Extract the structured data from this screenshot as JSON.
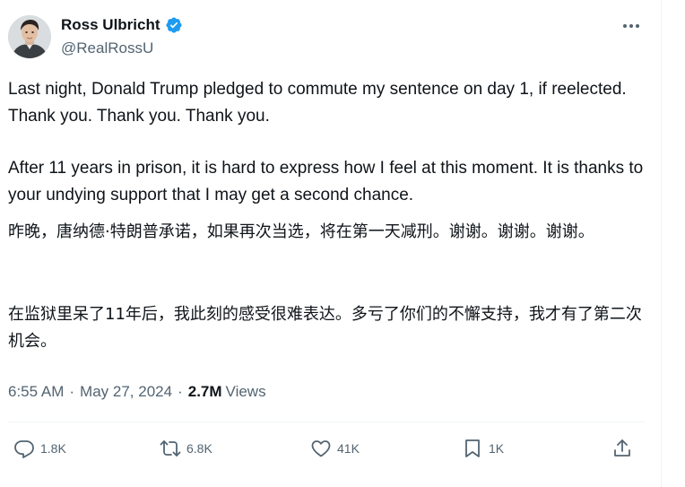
{
  "author": {
    "name": "Ross Ulbricht",
    "handle": "@RealRossU",
    "verified": true
  },
  "tweet": {
    "paragraphs": [
      "Last night, Donald Trump pledged to commute my sentence on day 1, if reelected. Thank you. Thank you. Thank you.",
      "After 11 years in prison, it is hard to express how I feel at this moment. It is thanks to your undying support that I may get a second chance.",
      "昨晚，唐纳德·特朗普承诺，如果再次当选，将在第一天减刑。谢谢。谢谢。谢谢。",
      "在监狱里呆了11年后，我此刻的感受很难表达。多亏了你们的不懈支持，我才有了第二次机会。"
    ],
    "time": "6:55 AM",
    "separator": "·",
    "date": "May 27, 2024",
    "views_count": "2.7M",
    "views_label": "Views"
  },
  "actions": {
    "reply": {
      "icon": "reply-icon",
      "count": "1.8K"
    },
    "retweet": {
      "icon": "retweet-icon",
      "count": "6.8K"
    },
    "like": {
      "icon": "heart-icon",
      "count": "41K"
    },
    "bookmark": {
      "icon": "bookmark-icon",
      "count": "1K"
    },
    "share": {
      "icon": "share-icon"
    }
  },
  "colors": {
    "text_primary": "#0f1419",
    "text_secondary": "#536471",
    "verified_blue": "#1d9bf0",
    "divider": "#eff3f4"
  }
}
